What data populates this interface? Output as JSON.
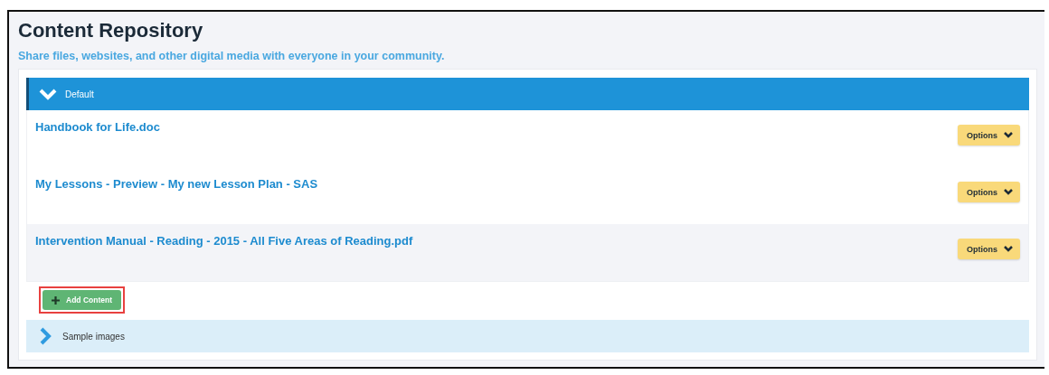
{
  "title": "Content Repository",
  "subtitle": "Share files, websites, and other digital media with everyone in your community.",
  "folders": [
    {
      "name": "Default",
      "expanded": true,
      "items": [
        {
          "title": "Handbook for Life.doc",
          "options": "Options",
          "highlighted": false
        },
        {
          "title": "My Lessons - Preview - My new Lesson Plan - SAS",
          "options": "Options",
          "highlighted": false
        },
        {
          "title": "Intervention Manual - Reading - 2015 - All Five Areas of Reading.pdf",
          "options": "Options",
          "highlighted": true
        }
      ],
      "add_button": {
        "label": "Add Content",
        "outlined": true
      }
    },
    {
      "name": "Sample images",
      "expanded": false
    }
  ]
}
